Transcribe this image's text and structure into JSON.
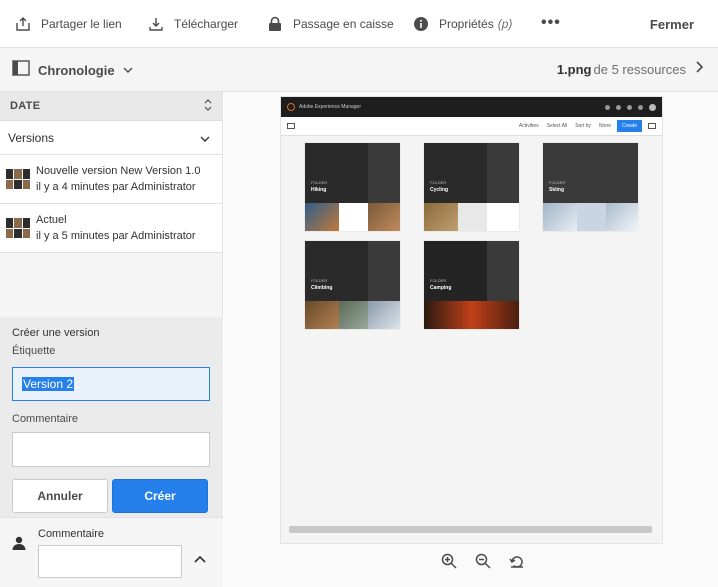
{
  "topbar": {
    "share_label": "Partager le lien",
    "download_label": "Télécharger",
    "checkout_label": "Passage en caisse",
    "properties_label": "Propriétés",
    "properties_shortcut": "(p)",
    "more_label": "•••",
    "close_label": "Fermer"
  },
  "subbar": {
    "rail_label": "Chronologie",
    "file_name": "1.png",
    "resources_label": "de 5 ressources"
  },
  "rail": {
    "date_header": "DATE",
    "filter_value": "Versions",
    "versions": [
      {
        "line1": "Nouvelle version New Version 1.0",
        "line2": "il y a 4 minutes par Administrator"
      },
      {
        "line1": "Actuel",
        "line2": "il y a 5 minutes par Administrator"
      }
    ],
    "create": {
      "title": "Créer une version",
      "label_label": "Étiquette",
      "label_value": "Version 2",
      "comment_label": "Commentaire",
      "cancel_label": "Annuler",
      "create_label": "Créer"
    },
    "comment": {
      "label": "Commentaire"
    }
  },
  "preview": {
    "app_title": "Adobe Experience Manager",
    "toolbar": {
      "activities": "Activities",
      "select_all": "Select All",
      "sort": "Sort by",
      "none": "None",
      "create": "Create"
    },
    "tiles": [
      {
        "kind": "FOLDER",
        "name": "Hiking"
      },
      {
        "kind": "FOLDER",
        "name": "Cycling"
      },
      {
        "kind": "FOLDER",
        "name": "Skiing"
      },
      {
        "kind": "FOLDER",
        "name": "Climbing"
      },
      {
        "kind": "FOLDER",
        "name": "Camping"
      }
    ]
  },
  "colors": {
    "accent": "#2680eb",
    "rail_bg": "#f5f5f5",
    "panel_bg": "#ebebeb"
  },
  "icons": [
    "share-icon",
    "download-icon",
    "lock-icon",
    "info-icon",
    "more-icon",
    "rail-icon",
    "chevron-down-icon",
    "next-icon",
    "sort-icon",
    "user-icon",
    "chevron-up-icon",
    "zoom-in-icon",
    "zoom-out-icon",
    "reset-icon"
  ]
}
